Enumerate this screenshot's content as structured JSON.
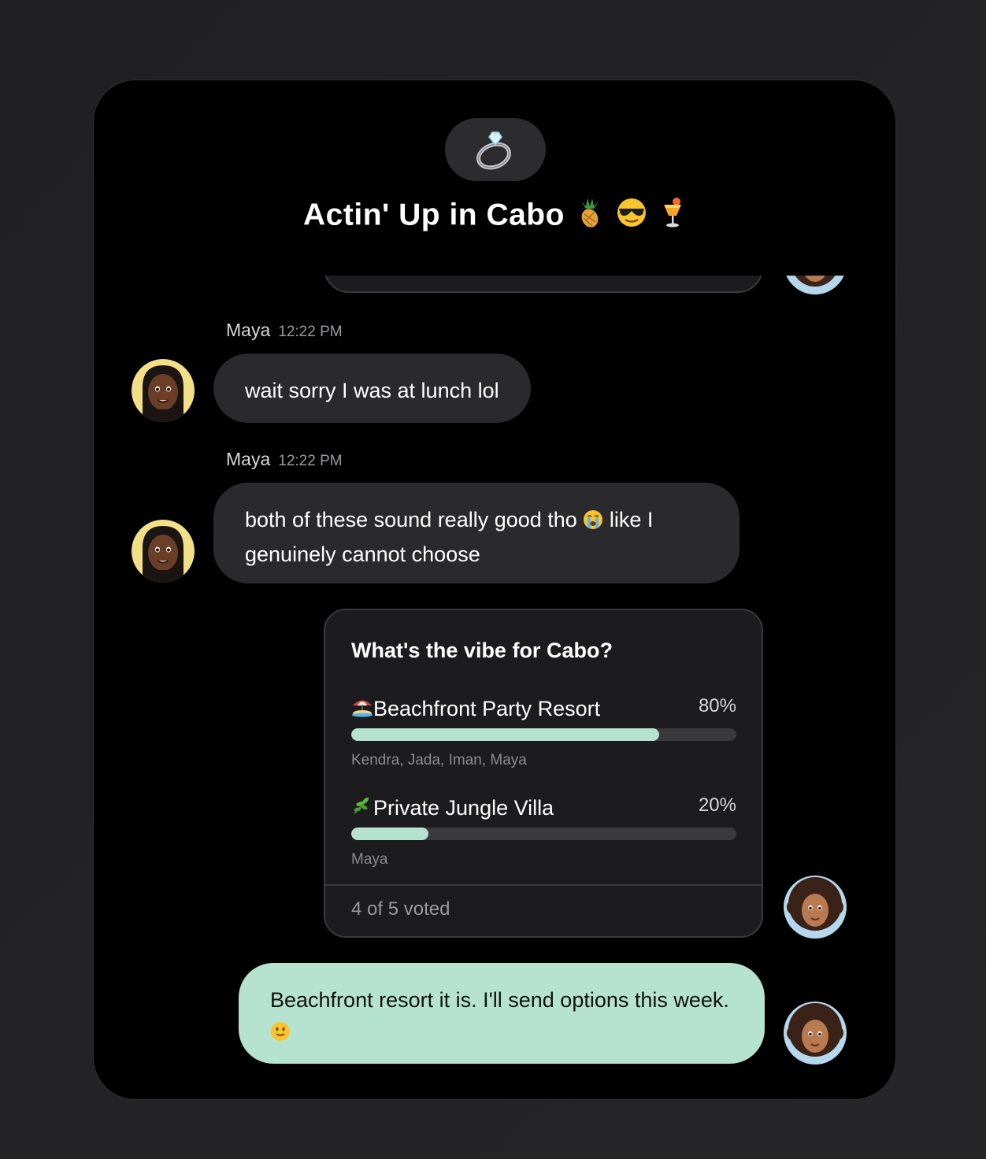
{
  "chat": {
    "title": "Actin' Up in Cabo",
    "group_icon": "ring-icon",
    "title_emojis": [
      "pineapple-icon",
      "sunglasses-face-icon",
      "tropical-drink-icon"
    ]
  },
  "messages": [
    {
      "sender": "Maya",
      "time": "12:22 PM",
      "text": "wait sorry I was at lunch lol"
    },
    {
      "sender": "Maya",
      "time": "12:22 PM",
      "text_before": "both of these sound really good tho",
      "emoji": "crying-face-icon",
      "text_after": "like I genuinely cannot choose"
    }
  ],
  "poll": {
    "question": "What's the vibe for Cabo?",
    "options": [
      {
        "icon": "beach-umbrella-icon",
        "label": "Beachfront Party Resort",
        "percent": "80%",
        "fraction": 0.8,
        "voters": "Kendra, Jada, Iman, Maya"
      },
      {
        "icon": "herb-icon",
        "label": "Private Jungle Villa",
        "percent": "20%",
        "fraction": 0.2,
        "voters": "Maya"
      }
    ],
    "footer": "4 of 5 voted"
  },
  "my_message": {
    "text": "Beachfront resort it is. I'll send options this week.",
    "emoji": "slightly-smiling-face-icon"
  },
  "colors": {
    "accent": "#b5e3cf",
    "bubble_other": "#2a2a2c",
    "card_bg": "#000000"
  }
}
